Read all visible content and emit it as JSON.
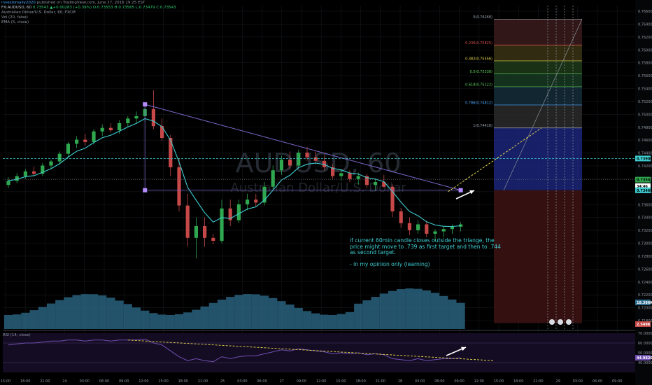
{
  "header": {
    "publisher": "investorsally2020",
    "published": "published on TradingView.com, June 27, 2016 19:25 EST",
    "symbol": "FX:AUDUSD, 60",
    "ohlc": "0.73543 ▲+0.00283 (+0.39%) O:0.73553 H:0.73565 L:0.73479 C:0.73543",
    "pair_title": "Australian Dollar/U.S. Dollar, 60, FXCM",
    "indicator_vol": "Vol (20, false)",
    "indicator_ema": "EMA (5, close)"
  },
  "watermark": {
    "symbol": "AUDUSD, 60",
    "name": "Australian Dollar/U.S. Dollar"
  },
  "note": {
    "line1": "if current 60min candle closes outside the triange, the price might move to .739 as first target and then to .744 as second target.",
    "line2": "- in my opinion only (learning)"
  },
  "rsi_label": "RSI (14, close)",
  "colors": {
    "up": "#2fa84f",
    "down": "#c64848",
    "ema": "#3fd0d4",
    "accent": "#3fd0d4",
    "volume": "#2f6f8f",
    "rsi": "#6f4fb0",
    "trend": "#7e6ad0",
    "yellow": "#e8d94a"
  },
  "chart_data": [
    {
      "type": "candlestick",
      "title": "Australian Dollar/U.S. Dollar, 60, FXCM",
      "ylim": [
        0.71,
        0.765
      ],
      "price_ticks": [
        "0.76600",
        "0.76400",
        "0.76200",
        "0.76000",
        "0.75800",
        "0.75600",
        "0.75400",
        "0.75200",
        "0.75000",
        "0.74800",
        "0.74600",
        "0.74400",
        "0.74200",
        "0.74000",
        "0.73800",
        "0.73600",
        "0.73400",
        "0.73200",
        "0.73000",
        "0.72800",
        "0.72600",
        "0.72400",
        "0.72200",
        "0.72000",
        "0.71800"
      ],
      "time_ticks": [
        "15:00",
        "18:00",
        "21:00",
        "24",
        "03:00",
        "06:00",
        "09:00",
        "12:00",
        "15:00",
        "18:00",
        "21:00",
        "25",
        "03:00",
        "06:00",
        "27",
        "09:00",
        "12:00",
        "15:00",
        "18:00",
        "21:00",
        "28",
        "03:00",
        "06:00",
        "09:00",
        "12:00",
        "15:00",
        "18:00",
        "21:00",
        "29",
        "03:00",
        "06:00",
        "09:00"
      ],
      "candles": [
        [
          0.7345,
          0.7358,
          0.734,
          0.7352
        ],
        [
          0.7352,
          0.7365,
          0.7348,
          0.736
        ],
        [
          0.736,
          0.7372,
          0.7355,
          0.7368
        ],
        [
          0.7368,
          0.7376,
          0.736,
          0.7364
        ],
        [
          0.7364,
          0.7382,
          0.736,
          0.7378
        ],
        [
          0.7378,
          0.7388,
          0.7372,
          0.7385
        ],
        [
          0.7385,
          0.7402,
          0.738,
          0.7398
        ],
        [
          0.7398,
          0.7418,
          0.7392,
          0.7415
        ],
        [
          0.7415,
          0.7428,
          0.7408,
          0.7422
        ],
        [
          0.7422,
          0.7432,
          0.7412,
          0.7418
        ],
        [
          0.7418,
          0.744,
          0.7414,
          0.7436
        ],
        [
          0.7436,
          0.7448,
          0.7428,
          0.7442
        ],
        [
          0.7442,
          0.745,
          0.7434,
          0.7438
        ],
        [
          0.7438,
          0.7455,
          0.7432,
          0.745
        ],
        [
          0.745,
          0.7462,
          0.7444,
          0.7458
        ],
        [
          0.7458,
          0.747,
          0.745,
          0.7462
        ],
        [
          0.7462,
          0.748,
          0.7452,
          0.7474
        ],
        [
          0.7474,
          0.7506,
          0.744,
          0.7445
        ],
        [
          0.7445,
          0.7458,
          0.742,
          0.7425
        ],
        [
          0.7425,
          0.743,
          0.736,
          0.7375
        ],
        [
          0.7375,
          0.739,
          0.73,
          0.731
        ],
        [
          0.731,
          0.733,
          0.724,
          0.7255
        ],
        [
          0.7255,
          0.729,
          0.722,
          0.7275
        ],
        [
          0.7275,
          0.729,
          0.724,
          0.7255
        ],
        [
          0.7255,
          0.7262,
          0.7244,
          0.725
        ],
        [
          0.725,
          0.732,
          0.7246,
          0.7305
        ],
        [
          0.7305,
          0.732,
          0.7275,
          0.7285
        ],
        [
          0.7285,
          0.732,
          0.728,
          0.7312
        ],
        [
          0.7312,
          0.733,
          0.7302,
          0.732
        ],
        [
          0.732,
          0.733,
          0.7308,
          0.7315
        ],
        [
          0.7315,
          0.735,
          0.731,
          0.7342
        ],
        [
          0.7342,
          0.7378,
          0.7338,
          0.737
        ],
        [
          0.737,
          0.7395,
          0.7362,
          0.7388
        ],
        [
          0.7388,
          0.7402,
          0.7372,
          0.7378
        ],
        [
          0.7378,
          0.7405,
          0.7374,
          0.74
        ],
        [
          0.74,
          0.741,
          0.7386,
          0.7392
        ],
        [
          0.7392,
          0.7402,
          0.738,
          0.7386
        ],
        [
          0.7386,
          0.7396,
          0.737,
          0.7375
        ],
        [
          0.7375,
          0.738,
          0.7355,
          0.736
        ],
        [
          0.736,
          0.7372,
          0.7352,
          0.7365
        ],
        [
          0.7365,
          0.737,
          0.735,
          0.7355
        ],
        [
          0.7355,
          0.7366,
          0.7345,
          0.736
        ],
        [
          0.736,
          0.7364,
          0.734,
          0.7345
        ],
        [
          0.7345,
          0.7356,
          0.7335,
          0.735
        ],
        [
          0.735,
          0.7362,
          0.734,
          0.7342
        ],
        [
          0.7342,
          0.7346,
          0.729,
          0.73
        ],
        [
          0.73,
          0.7306,
          0.7272,
          0.728
        ],
        [
          0.728,
          0.729,
          0.726,
          0.7268
        ],
        [
          0.7268,
          0.7285,
          0.7262,
          0.7278
        ],
        [
          0.7278,
          0.7284,
          0.7256,
          0.7262
        ],
        [
          0.7262,
          0.727,
          0.725,
          0.7266
        ],
        [
          0.7266,
          0.7274,
          0.7256,
          0.727
        ],
        [
          0.727,
          0.7278,
          0.7262,
          0.7274
        ],
        [
          0.7274,
          0.7282,
          0.7266,
          0.7278
        ]
      ],
      "fibonacci": [
        {
          "label": "0(0.76268)",
          "value": 0.7627,
          "color": "#9aa3ad"
        },
        {
          "label": "0.236(0.75825)",
          "value": 0.7583,
          "color": "#d9534f"
        },
        {
          "label": "0.382(0.75556)",
          "value": 0.7556,
          "color": "#e8d94a"
        },
        {
          "label": "0.5(0.75338)",
          "value": 0.7534,
          "color": "#5fd35f"
        },
        {
          "label": "0.618(0.75122)",
          "value": 0.7512,
          "color": "#5fd35f"
        },
        {
          "label": "0.786(0.74812)",
          "value": 0.7481,
          "color": "#4aa8ff"
        },
        {
          "label": "1(0.74418)",
          "value": 0.7442,
          "color": "#9aa3ad"
        }
      ],
      "price_tags": [
        {
          "label": "0.73900",
          "value": 0.739,
          "color": "#3fd0d4"
        },
        {
          "label": "0.73543",
          "value": 0.7354,
          "color": "#2fa84f"
        },
        {
          "label": "34:46",
          "value": 0.7343,
          "color": "#ffffff"
        },
        {
          "label": "0.73466",
          "value": 0.7336,
          "color": "#3fd0d4"
        }
      ],
      "volume_tags": [
        {
          "label": "18.386K",
          "color": "#2f6f8f"
        },
        {
          "label": "2.549K",
          "color": "#c64848"
        }
      ]
    },
    {
      "type": "line",
      "title": "RSI (14, close)",
      "ylim": [
        30,
        70
      ],
      "ticks": [
        "70.0000",
        "60.0000",
        "50.0000",
        "40.0000"
      ],
      "current": "44.9820",
      "values": [
        58,
        59,
        60,
        60,
        61,
        62,
        62,
        63,
        63,
        62,
        63,
        63,
        62,
        63,
        63,
        63,
        64,
        60,
        58,
        52,
        46,
        42,
        44,
        42,
        41,
        46,
        44,
        46,
        47,
        47,
        49,
        51,
        53,
        52,
        54,
        53,
        52,
        51,
        49,
        50,
        49,
        50,
        48,
        49,
        48,
        44,
        43,
        42,
        44,
        42,
        43,
        44,
        44,
        45
      ]
    }
  ]
}
